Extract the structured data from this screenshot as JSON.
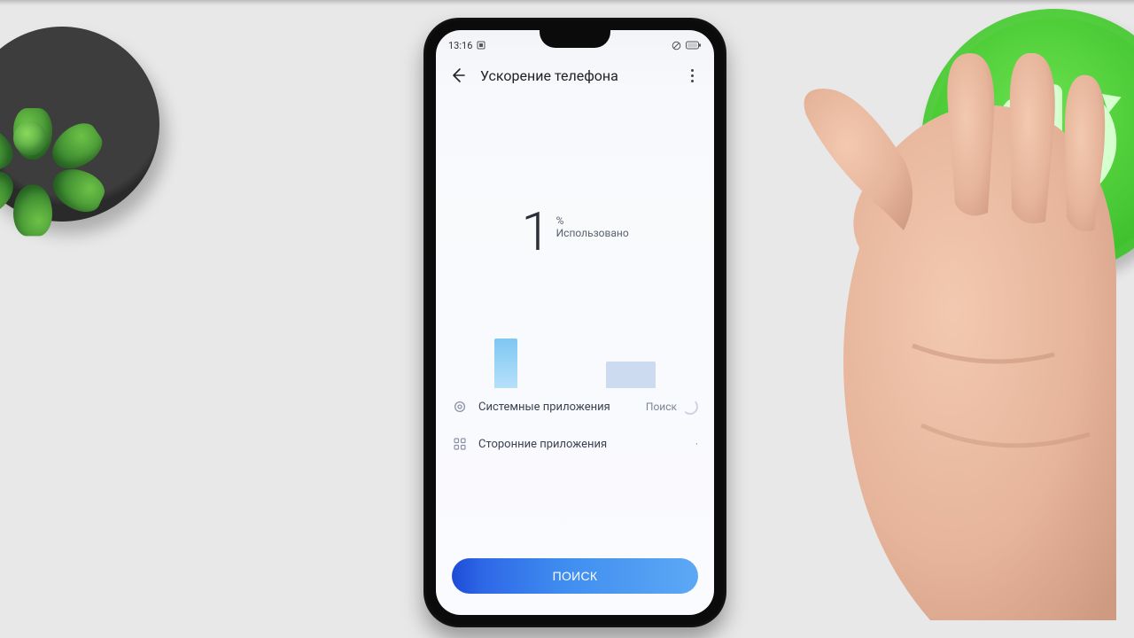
{
  "status_bar": {
    "time": "13:16"
  },
  "header": {
    "title": "Ускорение телефона"
  },
  "usage": {
    "value": "1",
    "percent_sign": "%",
    "label": "Использовано"
  },
  "rows": {
    "system_apps": {
      "label": "Системные приложения",
      "trailing": "Поиск"
    },
    "third_party": {
      "label": "Сторонние приложения"
    }
  },
  "primary_button": {
    "label": "ПОИСК"
  },
  "colors": {
    "button_gradient_start": "#1b4bd6",
    "button_gradient_end": "#5da8f5",
    "bar_primary": "#7fc7f2",
    "bar_secondary": "#c6d5ef",
    "coaster": "#4ed63a"
  },
  "chart_data": {
    "type": "bar",
    "categories": [
      "Системные приложения",
      "Сторонние приложения"
    ],
    "values": [
      56,
      30
    ],
    "title": "",
    "xlabel": "",
    "ylabel": "",
    "ylim": [
      0,
      60
    ]
  }
}
